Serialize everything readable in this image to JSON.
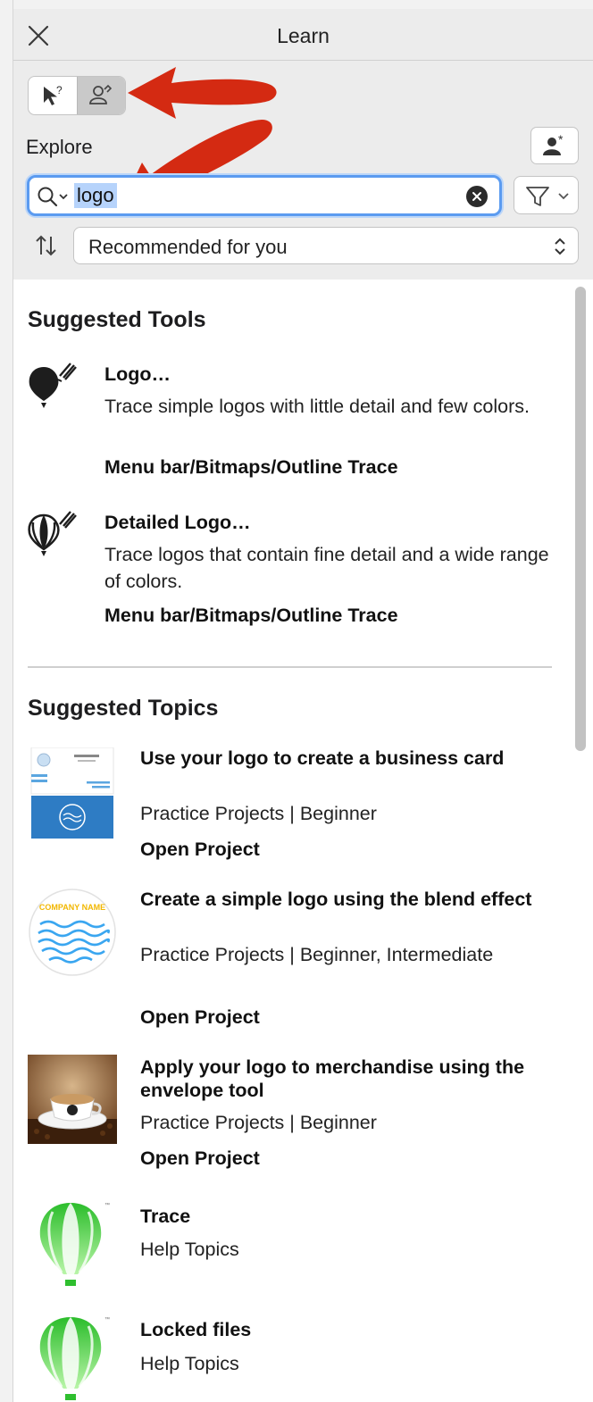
{
  "window": {
    "title": "Learn"
  },
  "mode_toggle": {
    "items": [
      {
        "icon": "pointer-help-icon",
        "active": false
      },
      {
        "icon": "learner-profile-icon",
        "active": true
      }
    ]
  },
  "explore": {
    "label": "Explore",
    "profile_icon": "person-star-icon"
  },
  "search": {
    "value": "logo",
    "clear_icon": "clear-icon",
    "filter_icon": "filter-icon"
  },
  "sort": {
    "selected": "Recommended for you"
  },
  "suggested_tools": {
    "heading": "Suggested Tools",
    "items": [
      {
        "title": "Logo…",
        "description": "Trace simple logos with little detail and few colors.",
        "path": "Menu bar/Bitmaps/Outline Trace",
        "icon": "logo-trace-icon"
      },
      {
        "title": "Detailed Logo…",
        "description": "Trace logos that contain fine detail and a wide range of colors.",
        "path": "Menu bar/Bitmaps/Outline Trace",
        "icon": "detailed-logo-trace-icon"
      }
    ]
  },
  "suggested_topics": {
    "heading": "Suggested Topics",
    "items": [
      {
        "title": "Use your logo to create a business card",
        "meta": "Practice Projects | Beginner",
        "link": "Open Project",
        "thumb": "business-card-thumbnail"
      },
      {
        "title": "Create a simple logo using the blend effect",
        "meta": "Practice Projects | Beginner, Intermediate",
        "link": "Open Project",
        "thumb": "company-logo-thumbnail",
        "thumb_text": "COMPANY NAME"
      },
      {
        "title": "Apply your logo to merchandise using the envelope tool",
        "meta": "Practice Projects | Beginner",
        "link": "Open Project",
        "thumb": "coffee-cup-thumbnail"
      },
      {
        "title": "Trace",
        "meta": "Help Topics",
        "thumb": "balloon-logo-thumbnail"
      },
      {
        "title": "Locked files",
        "meta": "Help Topics",
        "thumb": "balloon-logo-thumbnail"
      }
    ]
  },
  "colors": {
    "focus_ring": "#5b9bf0",
    "annotation_arrow": "#d42a12",
    "balloon_green": "#2fbf2f"
  }
}
